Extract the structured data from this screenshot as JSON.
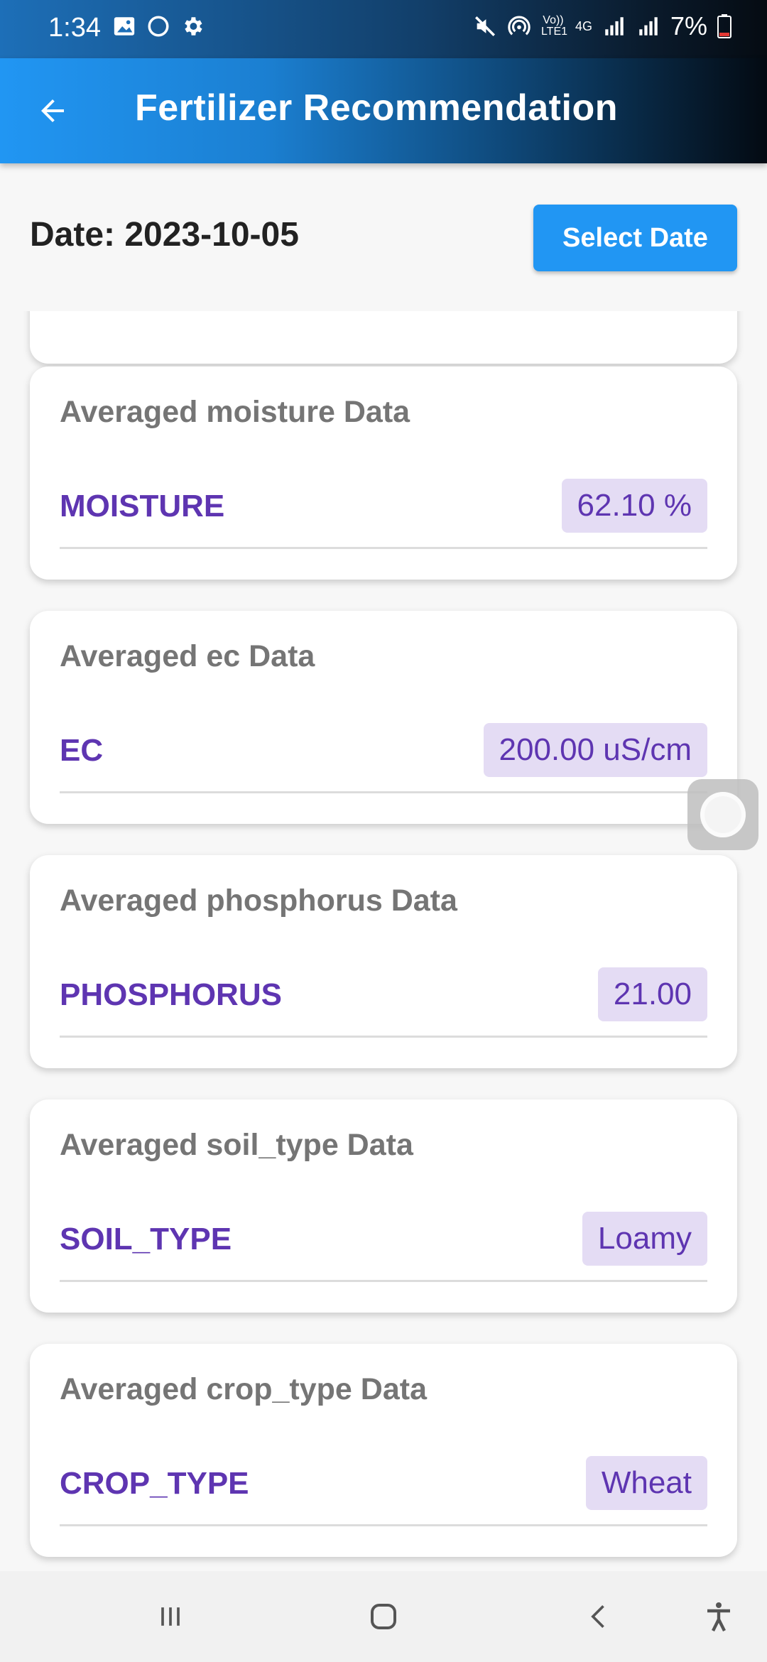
{
  "status_bar": {
    "time": "1:34",
    "battery": "7%",
    "network_labels": [
      "Vo)) LTE1",
      "4G"
    ],
    "left_icons": [
      "image-icon",
      "circle-icon",
      "gear-icon"
    ],
    "right_icons": [
      "mute-icon",
      "hotspot-icon",
      "signal-icon",
      "signal-icon",
      "battery-icon"
    ]
  },
  "app_bar": {
    "title": "Fertilizer Recommendation",
    "back_icon": "arrow-left-icon"
  },
  "date": {
    "label": "Date: 2023-10-05",
    "select_button": "Select Date"
  },
  "cards": [
    {
      "title": "Averaged moisture Data",
      "param": "MOISTURE",
      "value": "62.10 %"
    },
    {
      "title": "Averaged ec Data",
      "param": "EC",
      "value": "200.00 uS/cm"
    },
    {
      "title": "Averaged phosphorus Data",
      "param": "PHOSPHORUS",
      "value": "21.00"
    },
    {
      "title": "Averaged soil_type Data",
      "param": "SOIL_TYPE",
      "value": "Loamy"
    },
    {
      "title": "Averaged crop_type Data",
      "param": "CROP_TYPE",
      "value": "Wheat"
    }
  ],
  "nav_bar": {
    "icons": [
      "recents-icon",
      "home-icon",
      "back-icon",
      "accessibility-icon"
    ]
  },
  "colors": {
    "accent": "#2196f3",
    "param_text": "#5e35b1",
    "value_chip": "#e4dcf4",
    "card_title": "#757575"
  }
}
